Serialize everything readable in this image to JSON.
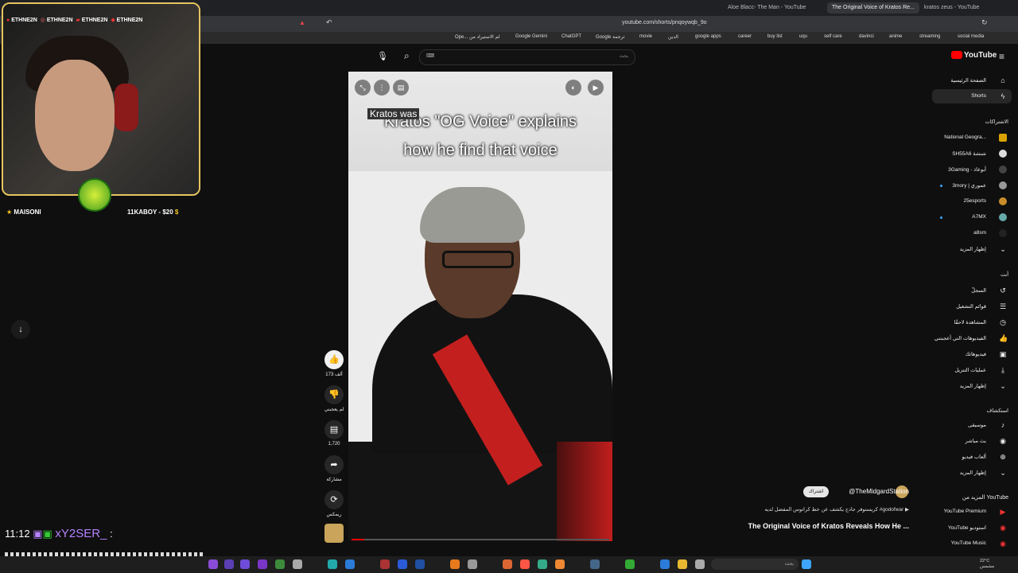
{
  "browser": {
    "tabs": [
      "Aloe Blacc- The Man - YouTube",
      "The Original Voice of Kratos Re...",
      "kratos zeus - YouTube"
    ],
    "url": "youtube.com/shorts/pnqoywqb_9o",
    "bookmarks": [
      "Ope... لم الاستيراد من",
      "Google Gemini",
      "ChatGPT",
      "Google ترجمة",
      "movie",
      "الدين",
      "google apps",
      "career",
      "buy list",
      "uqu",
      "self care",
      "davinci",
      "anime",
      "streaming",
      "social media"
    ]
  },
  "youtube": {
    "logo": "YouTube",
    "search_placeholder": "بحث",
    "search_kbd": "⌨"
  },
  "sidebar": {
    "home": "الصفحة الرئيسية",
    "shorts": "Shorts",
    "subs_heading": "الاشتراكات",
    "subscriptions": [
      "National Geogra...",
      "SH55A6 شنشة",
      "3Gaming - أبوعاذ",
      "3mory | عموري",
      "25esports",
      "A7MX",
      "a8sm"
    ],
    "show_more": "إظهار المزيد",
    "you_heading": "أنت",
    "you_items": [
      "السجلّ",
      "قوائم التشغيل",
      "المشاهدة لاحقًا",
      "الفيديوهات التي أعجبتني",
      "فيديوهاتك",
      "عمليات التنزيل",
      "إظهار المزيد"
    ],
    "explore_heading": "استكشاف",
    "explore_items": [
      "موسيقى",
      "بث مباشر",
      "ألعاب فيديو",
      "إظهار المزيد"
    ],
    "more_heading": "المزيد من YouTube",
    "more_items": [
      "YouTube Premium",
      "YouTube استوديو",
      "YouTube Music"
    ]
  },
  "video": {
    "caption_small": "Kratos was",
    "caption_line1": "Kratos \"OG Voice\" explains",
    "caption_line2": "how he find that voice",
    "progress": 0.05
  },
  "actions": {
    "likes": "173 ألف",
    "dislike": "لم يعجبني",
    "comments": "1,720",
    "share": "مشاركة",
    "remix": "ريمكس"
  },
  "info": {
    "channel": "@TheMidgardStation",
    "subscribe": "اشتراك",
    "description": "كريستوفر جادج يكشف عن خط كراتوس المفضل لديه #godofwar ▶",
    "title": "The Original Voice of Kratos Reveals How He ..."
  },
  "stream": {
    "social_handles": [
      "ETHNE2N",
      "ETHNE2N",
      "ETHNE2N",
      "ETHNE2N"
    ],
    "top_supporter": "MAISONI",
    "donation": "11KABOY - $20",
    "chat_time": "11:12",
    "chat_user": "xY2SER_",
    "chat_sep": ":"
  },
  "taskbar": {
    "search": "بحث",
    "weather_line1": "22°C",
    "weather_line2": "مشمس"
  }
}
